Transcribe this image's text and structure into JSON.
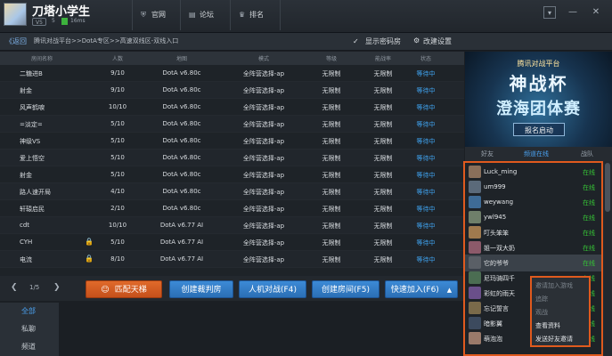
{
  "user": {
    "name": "刀塔小学生",
    "level": "V5",
    "score": "5",
    "ping": "16ms"
  },
  "nav": {
    "home": "官网",
    "forum": "论坛",
    "rank": "排名",
    "home_icon": "shield-icon",
    "forum_icon": "chat-icon",
    "rank_icon": "crown-icon"
  },
  "window": {
    "minimize": "—",
    "close": "✕",
    "menu": "▾"
  },
  "breadcrumb": {
    "back": "《返回",
    "path": "腾讯对战平台>>DotA专区>>高速双线区-双线入口"
  },
  "options": {
    "show_password_room": "显示密码房",
    "show_password_checked": true,
    "change_settings": "改建设置"
  },
  "table": {
    "headers": [
      "房间名称",
      "人数",
      "地图",
      "模式",
      "等级",
      "能战率",
      "状态"
    ],
    "rows": [
      {
        "name": "二糖进B",
        "count": "9/10",
        "map": "DotA v6.80c",
        "mode": "全阵营选择-ap",
        "level": "无限制",
        "rate": "无限制",
        "status": "等待中",
        "locked": false
      },
      {
        "name": "射金",
        "count": "9/10",
        "map": "DotA v6.80c",
        "mode": "全阵营选择-ap",
        "level": "无限制",
        "rate": "无限制",
        "status": "等待中",
        "locked": false
      },
      {
        "name": "风声鹤唳",
        "count": "10/10",
        "map": "DotA v6.80c",
        "mode": "全阵营选择-ap",
        "level": "无限制",
        "rate": "无限制",
        "status": "等待中",
        "locked": false
      },
      {
        "name": "=淡定=",
        "count": "5/10",
        "map": "DotA v6.80c",
        "mode": "全阵营选择-ap",
        "level": "无限制",
        "rate": "无限制",
        "status": "等待中",
        "locked": false
      },
      {
        "name": "神级VS",
        "count": "5/10",
        "map": "DotA v6.80c",
        "mode": "全阵营选择-ap",
        "level": "无限制",
        "rate": "无限制",
        "status": "等待中",
        "locked": false
      },
      {
        "name": "爱上悟空",
        "count": "5/10",
        "map": "DotA v6.80c",
        "mode": "全阵营选择-ap",
        "level": "无限制",
        "rate": "无限制",
        "status": "等待中",
        "locked": false
      },
      {
        "name": "射金",
        "count": "5/10",
        "map": "DotA v6.80c",
        "mode": "全阵营选择-ap",
        "level": "无限制",
        "rate": "无限制",
        "status": "等待中",
        "locked": false
      },
      {
        "name": "路人速开局",
        "count": "4/10",
        "map": "DotA v6.80c",
        "mode": "全阵营选择-ap",
        "level": "无限制",
        "rate": "无限制",
        "status": "等待中",
        "locked": false
      },
      {
        "name": "轩辕启民",
        "count": "2/10",
        "map": "DotA v6.80c",
        "mode": "全阵营选择-ap",
        "level": "无限制",
        "rate": "无限制",
        "status": "等待中",
        "locked": false
      },
      {
        "name": "cdt",
        "count": "10/10",
        "map": "DotA v6.77 AI",
        "mode": "全阵营选择-ap",
        "level": "无限制",
        "rate": "无限制",
        "status": "等待中",
        "locked": false
      },
      {
        "name": "CYH",
        "count": "5/10",
        "map": "DotA v6.77 AI",
        "mode": "全阵营选择-ap",
        "level": "无限制",
        "rate": "无限制",
        "status": "等待中",
        "locked": true
      },
      {
        "name": "电流",
        "count": "8/10",
        "map": "DotA v6.77 AI",
        "mode": "全阵营选择-ap",
        "level": "无限制",
        "rate": "无限制",
        "status": "等待中",
        "locked": true
      }
    ]
  },
  "pager": {
    "prev": "❮",
    "next": "❯",
    "text": "1/5"
  },
  "actions": {
    "ladder": "匹配天梯",
    "create_judge": "创建裁判房",
    "ai_battle": "人机对战(F4)",
    "create_room": "创建房间(F5)",
    "quick_join": "快速加入(F6)",
    "quick_join_arrow": "▲"
  },
  "chat_tabs": [
    "全部",
    "私聊",
    "频道"
  ],
  "banner": {
    "line1": "腾讯对战平台",
    "line2": "神战杯",
    "line3": "澄海团体赛",
    "button": "报名启动"
  },
  "panel_tabs": [
    "好友",
    "频道在线",
    "战队"
  ],
  "players": [
    {
      "name": "Luck_ming",
      "status": "在线",
      "color": "#8a6f5a"
    },
    {
      "name": "um999",
      "status": "在线",
      "color": "#5b6a7a"
    },
    {
      "name": "weywang",
      "status": "在线",
      "color": "#3e6b96"
    },
    {
      "name": "ywl945",
      "status": "在线",
      "color": "#6f7f6a"
    },
    {
      "name": "叮头笨笨",
      "status": "在线",
      "color": "#a07a4e"
    },
    {
      "name": "姐一双大奶",
      "status": "在线",
      "color": "#8c5a6a"
    },
    {
      "name": "它的爷爷",
      "status": "在线",
      "color": "#5a5f66"
    },
    {
      "name": "尼玛骑四千",
      "status": "在线",
      "color": "#4b6d52"
    },
    {
      "name": "彩虹的雨天",
      "status": "在线",
      "color": "#6a4f8a"
    },
    {
      "name": "忘记誓言",
      "status": "在线",
      "color": "#7a6a4a"
    },
    {
      "name": "暗影翼",
      "status": "在线",
      "color": "#3c4a5e"
    },
    {
      "name": "萌泡泡",
      "status": "在线",
      "color": "#9a7a6a"
    }
  ],
  "context_menu": [
    "邀请加入游戏",
    "追踪",
    "观战",
    "查看资料",
    "发送好友邀请"
  ]
}
